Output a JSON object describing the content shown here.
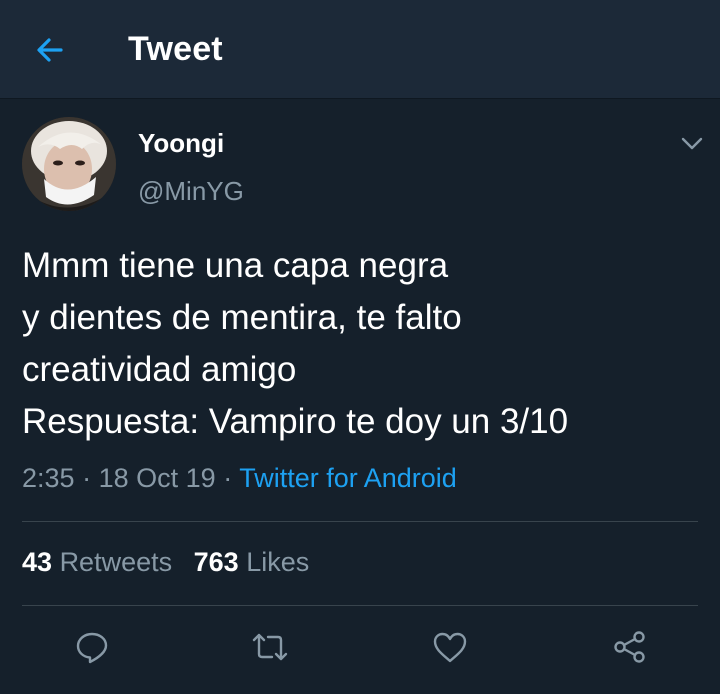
{
  "header": {
    "title": "Tweet",
    "back_icon": "back-arrow-icon"
  },
  "colors": {
    "background": "#15202b",
    "header": "#1c2938",
    "accent": "#1da1f2",
    "muted": "#8899a6"
  },
  "tweet": {
    "author": {
      "name": "Yoongi",
      "handle": "@MinYG"
    },
    "lines": [
      "Mmm tiene una capa negra",
      "y dientes de mentira, te falto",
      "creatividad amigo",
      "Respuesta: Vampiro te doy un 3/10"
    ],
    "time": "2:35",
    "date": "18 Oct 19",
    "separator": "·",
    "source": "Twitter for Android"
  },
  "stats": {
    "retweets": {
      "count": "43",
      "label": "Retweets"
    },
    "likes": {
      "count": "763",
      "label": "Likes"
    }
  },
  "actions": [
    "reply-icon",
    "retweet-icon",
    "like-icon",
    "share-icon"
  ]
}
